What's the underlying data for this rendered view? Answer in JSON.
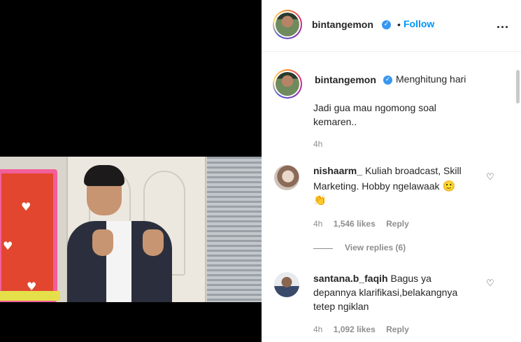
{
  "post": {
    "author": "bintangemon",
    "follow_label": "Follow",
    "separator": "•",
    "more_label": "...",
    "verified_mark": "✓"
  },
  "caption": {
    "username": "bintangemon",
    "line1": "Menghitung hari",
    "line2": "Jadi gua mau ngomong soal",
    "line3": "kemaren..",
    "time": "4h"
  },
  "comments": [
    {
      "username": "nishaarm_",
      "text_line1": "Kuliah broadcast, Skill",
      "text_line2": "Marketing. Hobby ngelawaak",
      "emoji1": "🙂",
      "emoji2": "👏",
      "time": "4h",
      "likes": "1,546 likes",
      "reply_label": "Reply",
      "view_replies": "View replies (6)"
    },
    {
      "username": "santana.b_faqih",
      "text_line1": "Bagus ya",
      "text_line2": "depannya klarifikasi,belakangnya",
      "text_line3": "tetep ngiklan",
      "time": "4h",
      "likes": "1,092 likes",
      "reply_label": "Reply"
    }
  ],
  "icons": {
    "heart": "♡"
  },
  "colors": {
    "link_blue": "#0095f6",
    "verified_blue": "#3897f0",
    "muted": "#8e8e8e",
    "text": "#262626"
  }
}
